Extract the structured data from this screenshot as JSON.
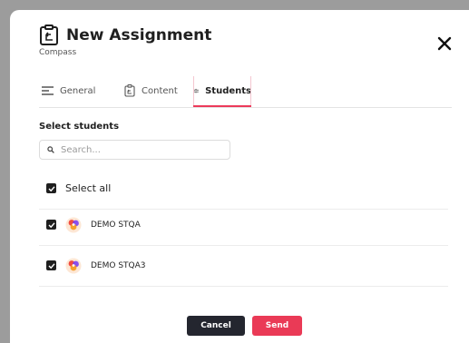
{
  "dialog": {
    "title": "New Assignment",
    "subtitle": "Compass",
    "close_icon": "close-icon"
  },
  "tabs": [
    {
      "label": "General",
      "icon": "lines-icon",
      "active": false
    },
    {
      "label": "Content",
      "icon": "clipboard-icon",
      "active": false
    },
    {
      "label": "Students",
      "icon": "students-icon",
      "active": true
    }
  ],
  "students_section": {
    "title": "Select students",
    "search_placeholder": "Search...",
    "select_all_label": "Select all",
    "select_all_checked": true,
    "students": [
      {
        "name": "DEMO STQA",
        "checked": true
      },
      {
        "name": "DEMO STQA3",
        "checked": true
      }
    ]
  },
  "footer": {
    "cancel_label": "Cancel",
    "send_label": "Send"
  },
  "colors": {
    "accent": "#ea3a56",
    "dark_button": "#24262f",
    "overlay": "#9c9c9c"
  }
}
